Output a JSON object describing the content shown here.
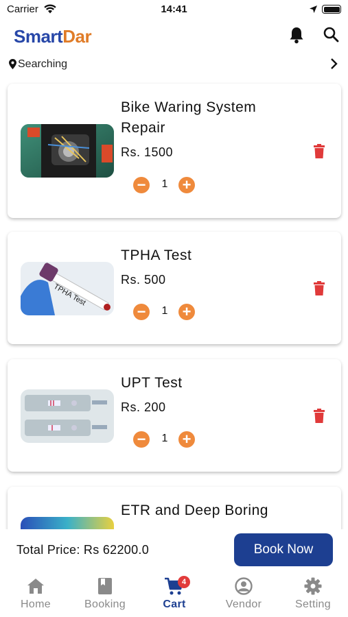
{
  "status": {
    "carrier": "Carrier",
    "time": "14:41"
  },
  "header": {
    "logo_part1": "Smart",
    "logo_part2": "Dar"
  },
  "location": {
    "text": "Searching"
  },
  "cart": {
    "items": [
      {
        "title": "Bike Waring System Repair",
        "price": "Rs. 1500",
        "qty": "1"
      },
      {
        "title": "TPHA Test",
        "price": "Rs. 500",
        "qty": "1",
        "thumb_label": "TPHA Test"
      },
      {
        "title": "UPT Test",
        "price": "Rs. 200",
        "qty": "1"
      },
      {
        "title": "ETR and Deep Boring"
      }
    ],
    "minus_symbol": "−",
    "plus_symbol": "+"
  },
  "footer": {
    "total": "Total Price: Rs 62200.0",
    "book_label": "Book Now"
  },
  "nav": {
    "items": [
      {
        "label": "Home",
        "icon": "home-icon"
      },
      {
        "label": "Booking",
        "icon": "book-icon"
      },
      {
        "label": "Cart",
        "icon": "cart-icon",
        "badge": "4"
      },
      {
        "label": "Vendor",
        "icon": "account-icon"
      },
      {
        "label": "Setting",
        "icon": "gear-icon"
      }
    ]
  },
  "colors": {
    "primary": "#1d3f91",
    "accent": "#ef8a3c",
    "delete": "#e03a3a"
  }
}
